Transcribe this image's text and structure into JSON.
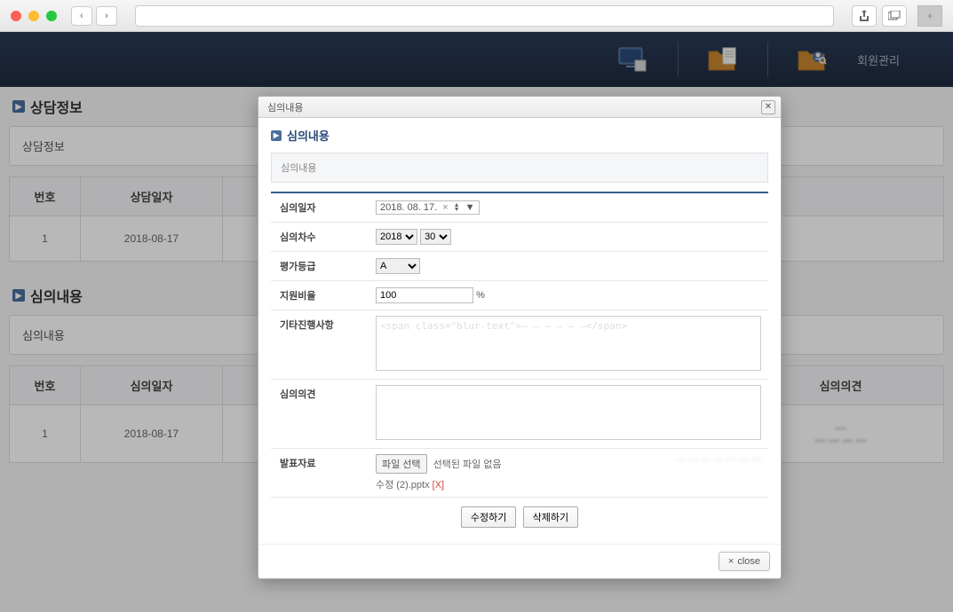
{
  "chrome": {
    "plus": "+"
  },
  "header": {
    "label_member": "회원관리"
  },
  "bg": {
    "section1_title": "상담정보",
    "section1_sub": "상담정보",
    "section2_title": "심의내용",
    "section2_sub": "심의내용",
    "t1": {
      "h1": "번호",
      "h2": "상담일자",
      "r1_no": "1",
      "r1_date": "2018-08-17"
    },
    "t2": {
      "h1": "번호",
      "h2": "심의일자",
      "h5": "심의의견",
      "r1_no": "1",
      "r1_date": "2018-08-17"
    }
  },
  "modal": {
    "bar_title": "심의내용",
    "sec_title": "심의내용",
    "sub_label": "심의내용",
    "labels": {
      "date": "심의일자",
      "count": "심의차수",
      "grade": "평가등급",
      "ratio": "지원비율",
      "other": "기타진행사항",
      "opinion": "심의의견",
      "file": "발표자료"
    },
    "date_value": "2018. 08. 17.",
    "year": "2018",
    "count_no": "30",
    "grade": "A",
    "ratio": "100",
    "ratio_unit": "%",
    "other_text": "",
    "opinion_text": "",
    "file_btn": "파일 선택",
    "file_none": "선택된 파일 없음",
    "file_name": "수정 (2).pptx",
    "file_del": "[X]",
    "btn_edit": "수정하기",
    "btn_delete": "삭제하기",
    "close_x": "×",
    "close_label": "close"
  }
}
